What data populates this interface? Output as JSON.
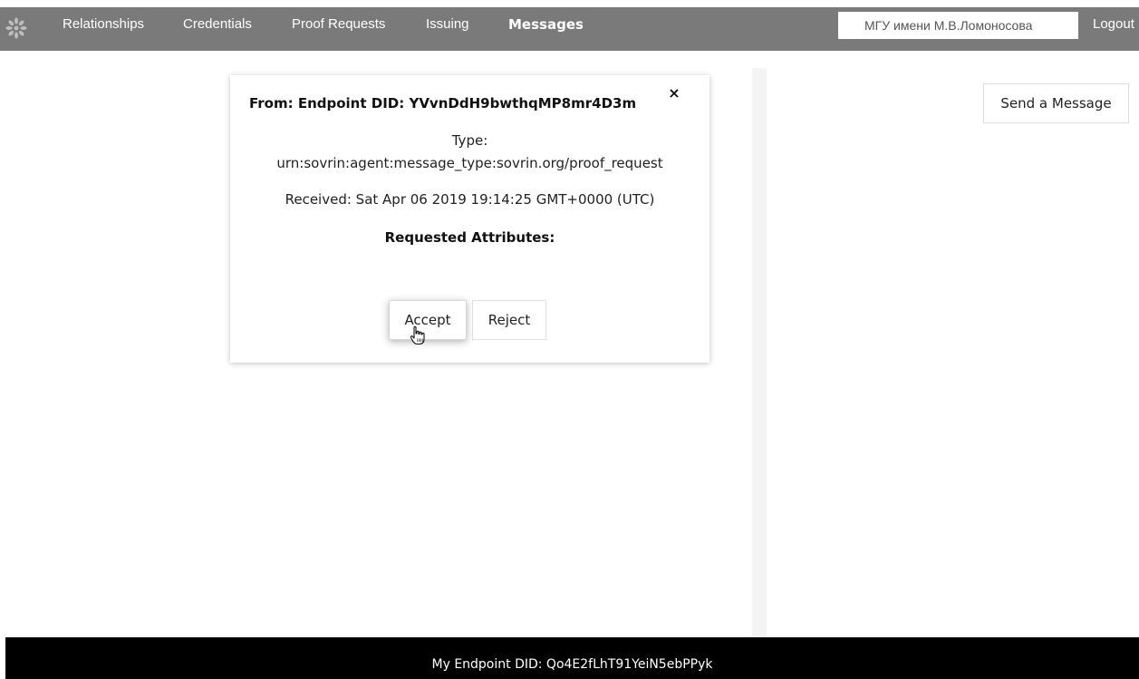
{
  "nav": {
    "logo_icon": "flower-logo-icon",
    "items": [
      {
        "label": "Relationships",
        "active": false
      },
      {
        "label": "Credentials",
        "active": false
      },
      {
        "label": "Proof Requests",
        "active": false
      },
      {
        "label": "Issuing",
        "active": false
      },
      {
        "label": "Messages",
        "active": true
      }
    ],
    "org_value": "МГУ имени М.В.Ломоносова",
    "logout_label": "Logout"
  },
  "message": {
    "from": "From: Endpoint DID: YVvnDdH9bwthqMP8mr4D3m",
    "close_glyph": "×",
    "type_label": "Type:",
    "type_value": "urn:sovrin:agent:message_type:sovrin.org/proof_request",
    "received": "Received: Sat Apr 06 2019 19:14:25 GMT+0000 (UTC)",
    "requested_attributes_label": "Requested Attributes:",
    "accept_label": "Accept",
    "reject_label": "Reject"
  },
  "send_message_label": "Send a Message",
  "footer": {
    "endpoint_did": "My Endpoint DID: Qo4E2fLhT91YeiN5ebPPyk"
  },
  "colors": {
    "nav_bg": "#7a7a7a",
    "footer_bg": "#000000",
    "page_bg": "#ffffff"
  }
}
